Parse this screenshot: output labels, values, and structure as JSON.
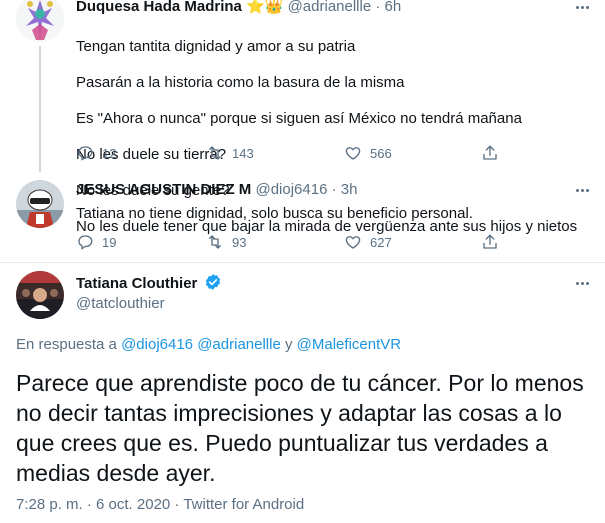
{
  "tweets": [
    {
      "name": "Duquesa Hada Madrina",
      "badges": "⭐👑",
      "handle": "@adrianellle",
      "separator": "·",
      "time": "6h",
      "lines": [
        "Tengan tantita dignidad y amor a su patria",
        "Pasarán a la historia como la basura de la misma",
        "Es \"Ahora o nunca\"  porque si siguen así México no tendrá mañana",
        "No les duele su tierra?",
        "No les duele su gente?",
        "No les duele tener que bajar la mirada de vergüenza ante sus hijos y nietos"
      ],
      "replies": "12",
      "retweets": "143",
      "likes": "566"
    },
    {
      "name": "JESUS AGUSTIN DIEZ M",
      "handle": "@dioj6416",
      "separator": "·",
      "time": "3h",
      "text": "Tatiana no tiene dignidad, solo busca su beneficio personal.",
      "replies": "19",
      "retweets": "93",
      "likes": "627"
    }
  ],
  "main_tweet": {
    "name": "Tatiana Clouthier",
    "handle": "@tatclouthier",
    "reply_prefix": "En respuesta a",
    "mention_1": "@dioj6416",
    "mention_2": "@adrianellle",
    "reply_and": "y",
    "mention_3": "@MaleficentVR",
    "text": "Parece que aprendiste poco de tu cáncer. Por lo menos no decir tantas imprecisiones y adaptar las cosas a lo que crees que es. Puedo puntualizar tus verdades a medias desde ayer.",
    "meta": "7:28 p. m. · 6 oct. 2020 · Twitter for Android"
  },
  "colors": {
    "text": "#0f1419",
    "secondary": "#5b7083",
    "link": "#1b95e0",
    "verified": "#1da1f2",
    "divider": "#e6ecf0"
  },
  "icons": [
    "reply-icon",
    "retweet-icon",
    "like-icon",
    "share-icon",
    "more-icon",
    "verified-icon"
  ]
}
